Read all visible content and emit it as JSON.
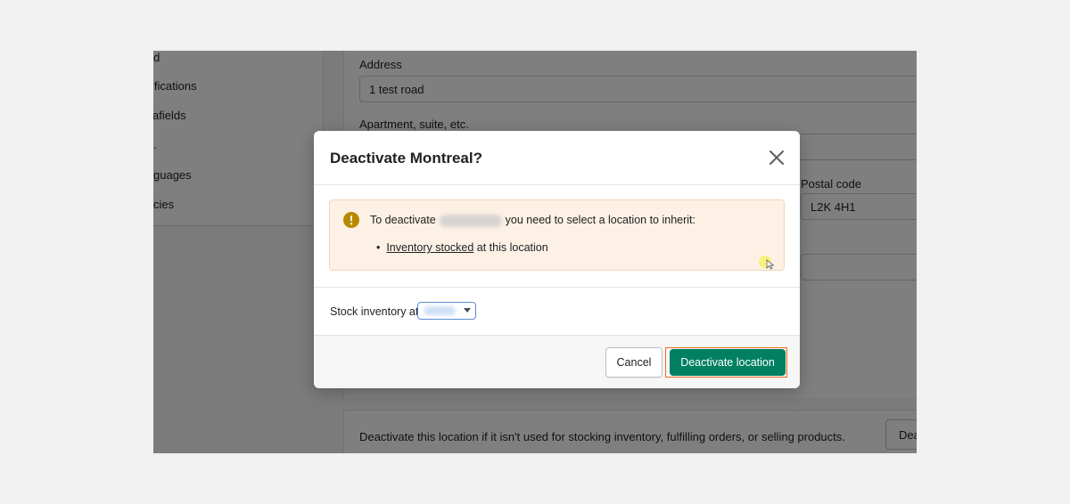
{
  "background_app": {
    "sidebar_items": [
      "d",
      "ifications",
      "afields",
      ".",
      "guages",
      "cies"
    ],
    "address_label": "Address",
    "address_value": "1 test road",
    "apartment_label": "Apartment, suite, etc.",
    "postal_code_label": "Postal code",
    "postal_code_value": "L2K 4H1",
    "deactivate_info": "Deactivate this location if it isn't used for stocking inventory, fulfilling orders, or selling products.",
    "deactivate_button_partial": "Dea"
  },
  "modal": {
    "title": "Deactivate Montreal?",
    "close_icon": "close-icon",
    "banner": {
      "icon": "warning-icon",
      "text_before": "To deactivate",
      "text_after": "you need to select a location to inherit:",
      "bullet_link": "Inventory stocked",
      "bullet_rest": " at this location"
    },
    "stock_label": "Stock inventory at",
    "cancel_label": "Cancel",
    "deactivate_label": "Deactivate location"
  },
  "colors": {
    "primary": "#008060",
    "highlight": "#f26b1d",
    "banner_bg": "#fdf1e6",
    "warning_icon": "#b98900"
  }
}
